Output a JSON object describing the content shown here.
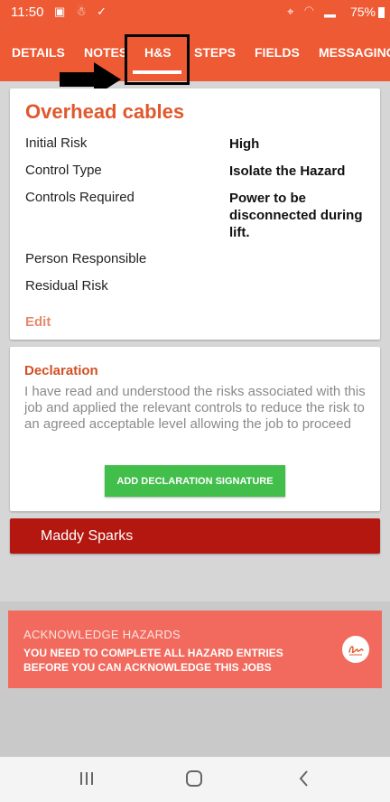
{
  "status_bar": {
    "time": "11:50",
    "left_icons": "▣ ☃ ✓",
    "right_icons": "⌖ ◠ ▂",
    "battery": "75%"
  },
  "tabs": [
    {
      "label": "DETAILS"
    },
    {
      "label": "NOTES"
    },
    {
      "label": "H&S",
      "active": true
    },
    {
      "label": "STEPS"
    },
    {
      "label": "FIELDS"
    },
    {
      "label": "MESSAGING"
    }
  ],
  "hazard": {
    "title": "Overhead cables",
    "rows": [
      {
        "label": "Initial Risk",
        "value": "High"
      },
      {
        "label": "Control Type",
        "value": "Isolate the Hazard"
      },
      {
        "label": "Controls Required",
        "value": "Power to be disconnected during lift."
      },
      {
        "label": "Person Responsible",
        "value": ""
      },
      {
        "label": "Residual Risk",
        "value": ""
      }
    ],
    "edit_label": "Edit"
  },
  "declaration": {
    "title": "Declaration",
    "text": "I have read and understood the risks associated with this job and applied the relevant controls to reduce the risk to an agreed acceptable level allowing the job to proceed",
    "button_label": "ADD DECLARATION SIGNATURE"
  },
  "person": {
    "name": "Maddy Sparks"
  },
  "acknowledge": {
    "title": "ACKNOWLEDGE HAZARDS",
    "message": "YOU NEED TO COMPLETE ALL HAZARD ENTRIES BEFORE YOU CAN ACKNOWLEDGE THIS JOBS"
  },
  "colors": {
    "brand": "#ee5a33",
    "title": "#e0582c",
    "name_bar": "#b3170f",
    "banner": "#f26a5e",
    "button": "#42be4b"
  }
}
